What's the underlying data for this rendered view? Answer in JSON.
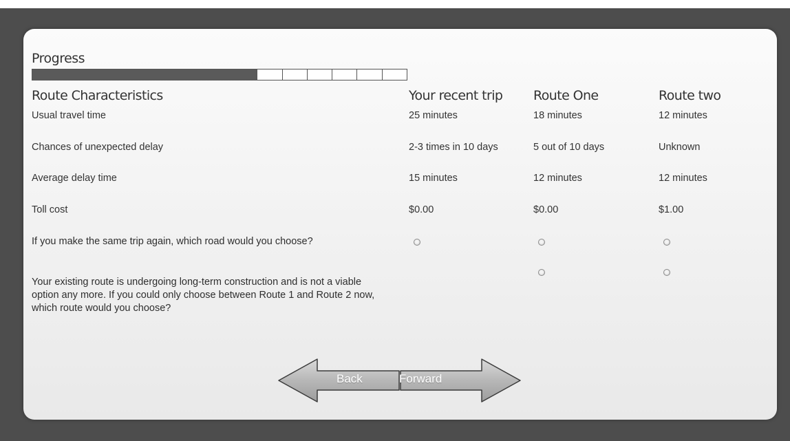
{
  "progress": {
    "title": "Progress",
    "value": 0.6,
    "segments_remaining": 6
  },
  "table": {
    "header": {
      "characteristics": "Route Characteristics",
      "recent": "Your recent trip",
      "route_one": "Route One",
      "route_two": "Route two"
    },
    "rows": [
      {
        "label": "Usual travel time",
        "recent": "25 minutes",
        "route_one": "18 minutes",
        "route_two": "12 minutes"
      },
      {
        "label": "Chances of unexpected delay",
        "recent": "2-3 times in 10 days",
        "route_one": "5 out of 10 days",
        "route_two": "Unknown"
      },
      {
        "label": "Average delay time",
        "recent": "15 minutes",
        "route_one": "12 minutes",
        "route_two": "12 minutes"
      },
      {
        "label": "Toll cost",
        "recent": "$0.00",
        "route_one": "$0.00",
        "route_two": "$1.00"
      }
    ]
  },
  "questions": {
    "q1": "If you make the same trip again, which road would you choose?",
    "q2": "Your existing route is undergoing long-term construction and is not a viable option any more. If you could only choose between Route 1 and Route 2 now, which route would you choose?"
  },
  "nav": {
    "back_label": "Back",
    "forward_label": "Forward"
  },
  "colors": {
    "background": "#4d4d4d",
    "progress_fill": "#5a5a5a",
    "arrow_fill": "#bdbdbd"
  }
}
